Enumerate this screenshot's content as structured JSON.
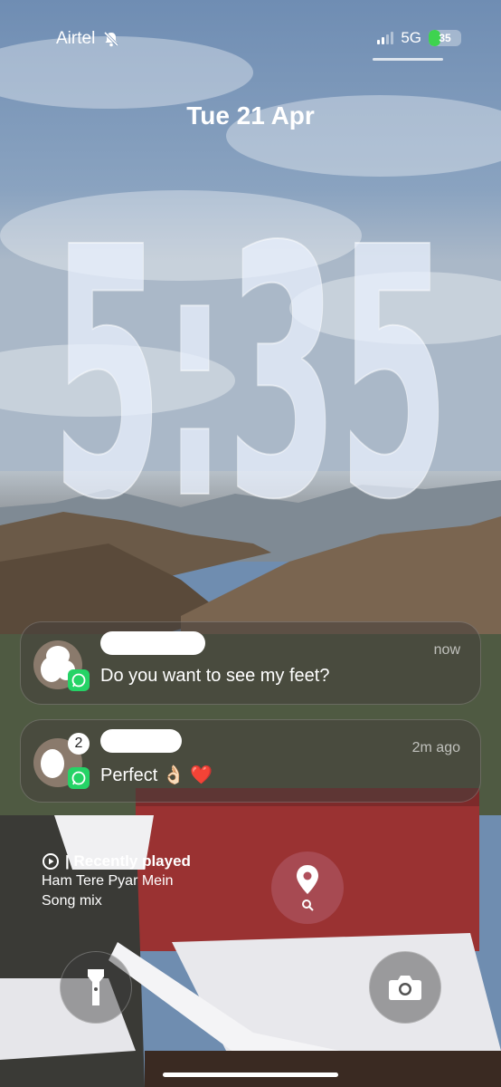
{
  "status_bar": {
    "carrier": "Airtel",
    "network": "5G",
    "battery": "35",
    "battery_level": 0.35,
    "colors": {
      "battery_fill": "#3ed34f"
    },
    "icons": [
      "bell-slash-icon",
      "signal-icon",
      "battery-icon"
    ]
  },
  "lock_screen": {
    "date": "Tue 21 Apr",
    "time": "5:35"
  },
  "notifications": [
    {
      "app": "WhatsApp",
      "message": "Do you want to see my feet?",
      "time": "now"
    },
    {
      "app": "WhatsApp",
      "message": "Perfect 👌🏻 ❤️",
      "time": "2m ago",
      "count": "2"
    }
  ],
  "media_widget": {
    "title": "| Recently played",
    "song": "Ham Tere Pyar Mein",
    "subtitle": "Song mix"
  },
  "buttons": {
    "flashlight_icon": "flashlight-icon",
    "camera_icon": "camera-icon",
    "find_my_icon": "location-pin-icon"
  }
}
